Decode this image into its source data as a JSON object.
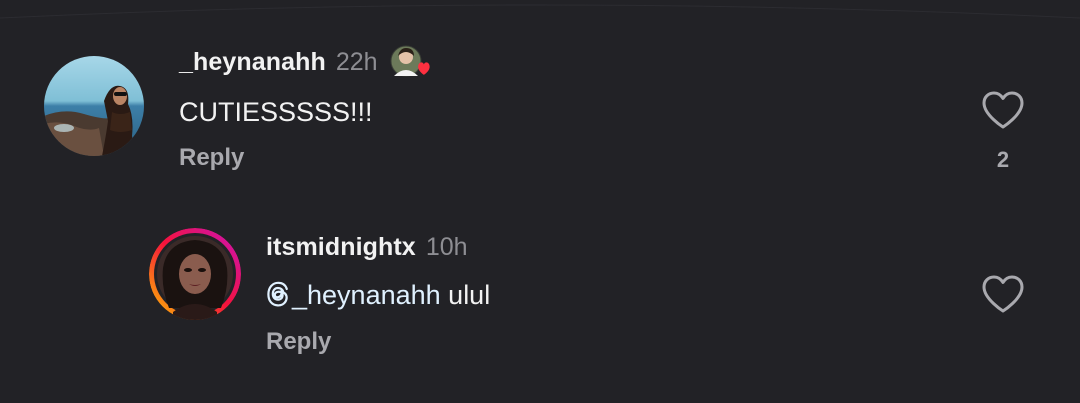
{
  "comments": [
    {
      "username": "_heynanahh",
      "time": "22h",
      "text": "CUTIESSSSS!!!",
      "reply_label": "Reply",
      "like_count": "2",
      "liked_by_creator": true,
      "avatar": "beach-photo-avatar"
    },
    {
      "username": "itsmidnightx",
      "time": "10h",
      "mention": "_heynanahh",
      "text": "ulul",
      "reply_label": "Reply",
      "avatar": "story-ring-avatar"
    }
  ],
  "icons": {
    "like": "heart-outline-icon",
    "creator_like": "creator-liked-heart-icon",
    "mention": "threads-at-icon"
  },
  "colors": {
    "background": "#222226",
    "text": "#f2f2f2",
    "muted": "#8e8e93",
    "reply": "#a9a9ae",
    "heart_red": "#ff3040",
    "story_ring_start": "#fdc500",
    "story_ring_end": "#c913b9"
  }
}
